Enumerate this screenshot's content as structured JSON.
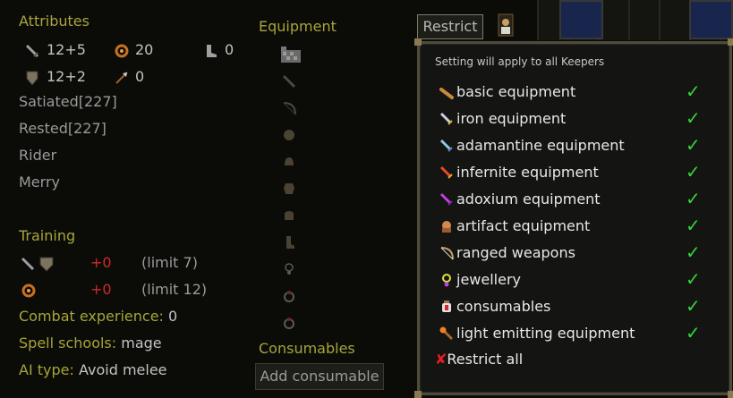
{
  "attributes": {
    "heading": "Attributes",
    "melee": "12+5",
    "magic": "20",
    "speed": "0",
    "defense": "12+2",
    "ranged": "0",
    "statuses": [
      "Satiated[227]",
      "Rested[227]",
      "Rider",
      "Merry"
    ]
  },
  "training": {
    "heading": "Training",
    "rows": [
      {
        "delta": "+0",
        "limit": "(limit 7)"
      },
      {
        "delta": "+0",
        "limit": "(limit 12)"
      }
    ]
  },
  "info": {
    "combat_label": "Combat experience:",
    "combat_value": "0",
    "spell_label": "Spell schools:",
    "spell_value": "mage",
    "ai_label": "AI type:",
    "ai_value": "Avoid melee"
  },
  "equipment": {
    "heading": "Equipment",
    "consumables_heading": "Consumables",
    "add_consumable": "Add consumable"
  },
  "restrict": {
    "button": "Restrict",
    "note": "Setting will apply to all Keepers",
    "items": [
      {
        "label": "basic equipment",
        "icon": "club-icon",
        "checked": true
      },
      {
        "label": "iron equipment",
        "icon": "iron-sword-icon",
        "checked": true
      },
      {
        "label": "adamantine equipment",
        "icon": "adamantine-sword-icon",
        "checked": true
      },
      {
        "label": "infernite equipment",
        "icon": "infernite-sword-icon",
        "checked": true
      },
      {
        "label": "adoxium equipment",
        "icon": "adoxium-sword-icon",
        "checked": true
      },
      {
        "label": "artifact equipment",
        "icon": "artifact-icon",
        "checked": true
      },
      {
        "label": "ranged weapons",
        "icon": "bow-icon",
        "checked": true
      },
      {
        "label": "jewellery",
        "icon": "amulet-icon",
        "checked": true
      },
      {
        "label": "consumables",
        "icon": "potion-icon",
        "checked": true
      },
      {
        "label": "light emitting equipment",
        "icon": "torch-icon",
        "checked": true
      }
    ],
    "check_glyph": "✓",
    "restrict_all": "Restrict all",
    "restrict_all_glyph": "✘"
  },
  "colors": {
    "heading": "#a7a53a",
    "check": "#33d63a",
    "red": "#d02a2a"
  }
}
